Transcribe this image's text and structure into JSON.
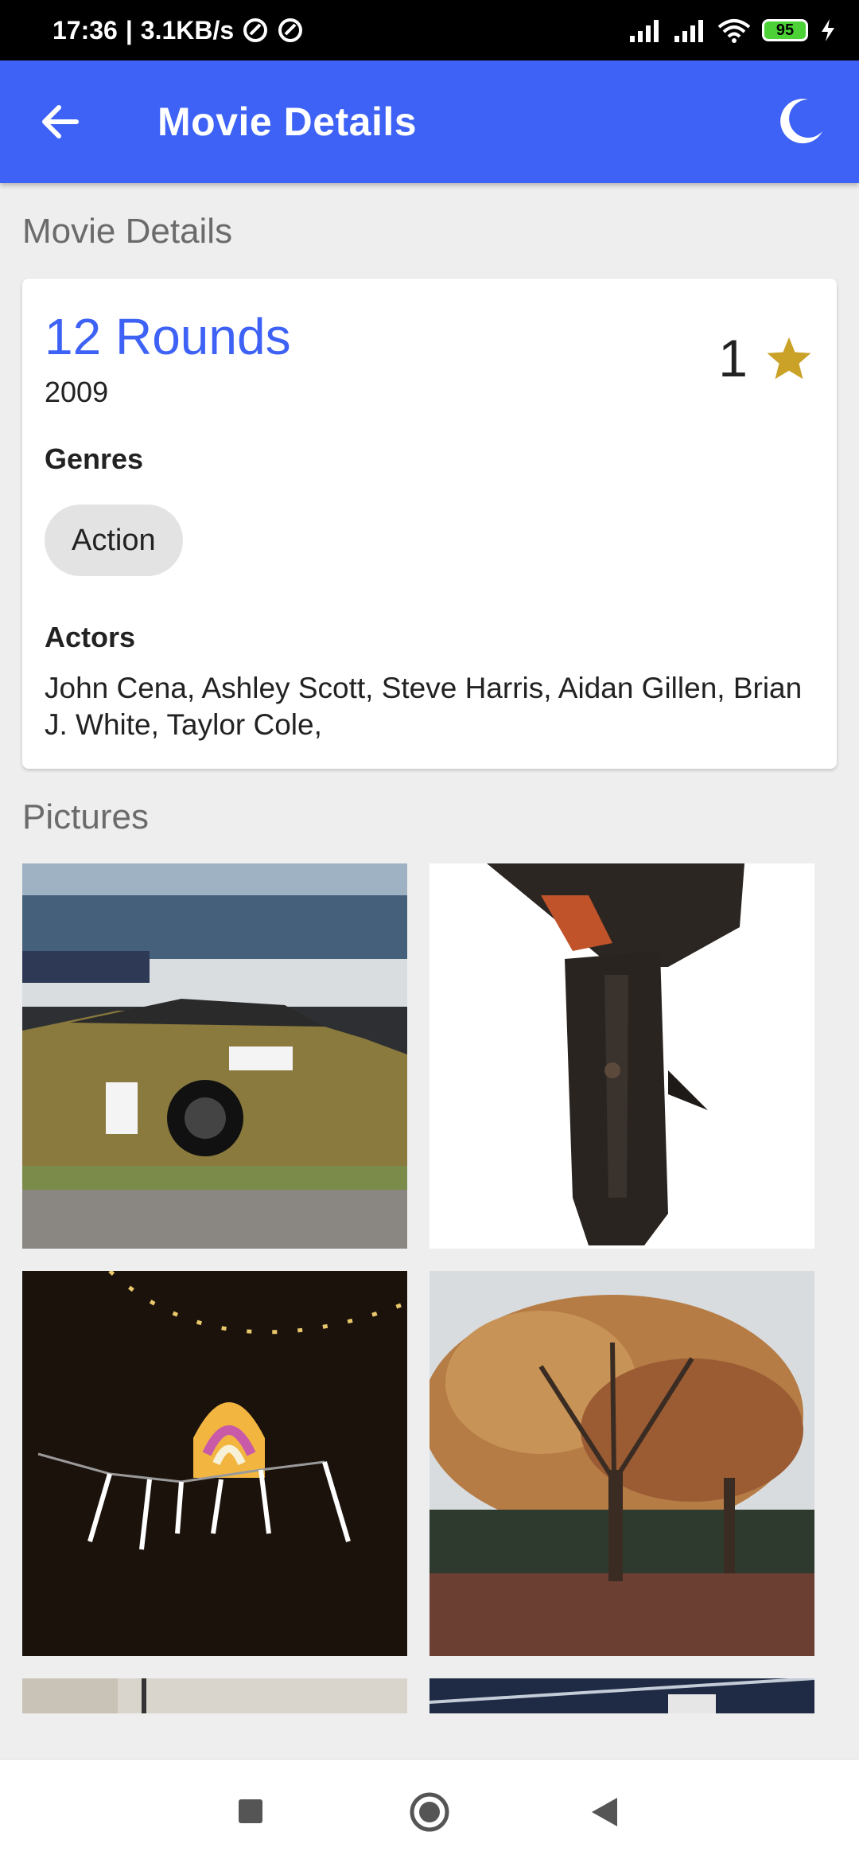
{
  "status_bar": {
    "time": "17:36",
    "network_speed": "3.1KB/s",
    "battery": "95"
  },
  "app_bar": {
    "title": "Movie Details",
    "back_icon": "arrow-left-icon",
    "theme_icon": "moon-icon"
  },
  "sections": {
    "details_title": "Movie Details",
    "pictures_title": "Pictures"
  },
  "movie": {
    "title": "12 Rounds",
    "year": "2009",
    "rating": "1",
    "genres_label": "Genres",
    "genres": [
      "Action"
    ],
    "actors_label": "Actors",
    "actors": "John Cena, Ashley Scott, Steve Harris, Aidan Gillen, Brian J. White, Taylor Cole,"
  },
  "pictures": [
    {
      "subject": "race car"
    },
    {
      "subject": "revolver holster"
    },
    {
      "subject": "rainbow lantern"
    },
    {
      "subject": "autumn tree"
    },
    {
      "subject": "partial image"
    },
    {
      "subject": "partial image"
    }
  ],
  "colors": {
    "primary": "#3d62f5",
    "star": "#c9a227",
    "background": "#eeeeee"
  },
  "nav": {
    "icons": [
      "recent-apps-icon",
      "home-icon",
      "back-icon"
    ]
  }
}
